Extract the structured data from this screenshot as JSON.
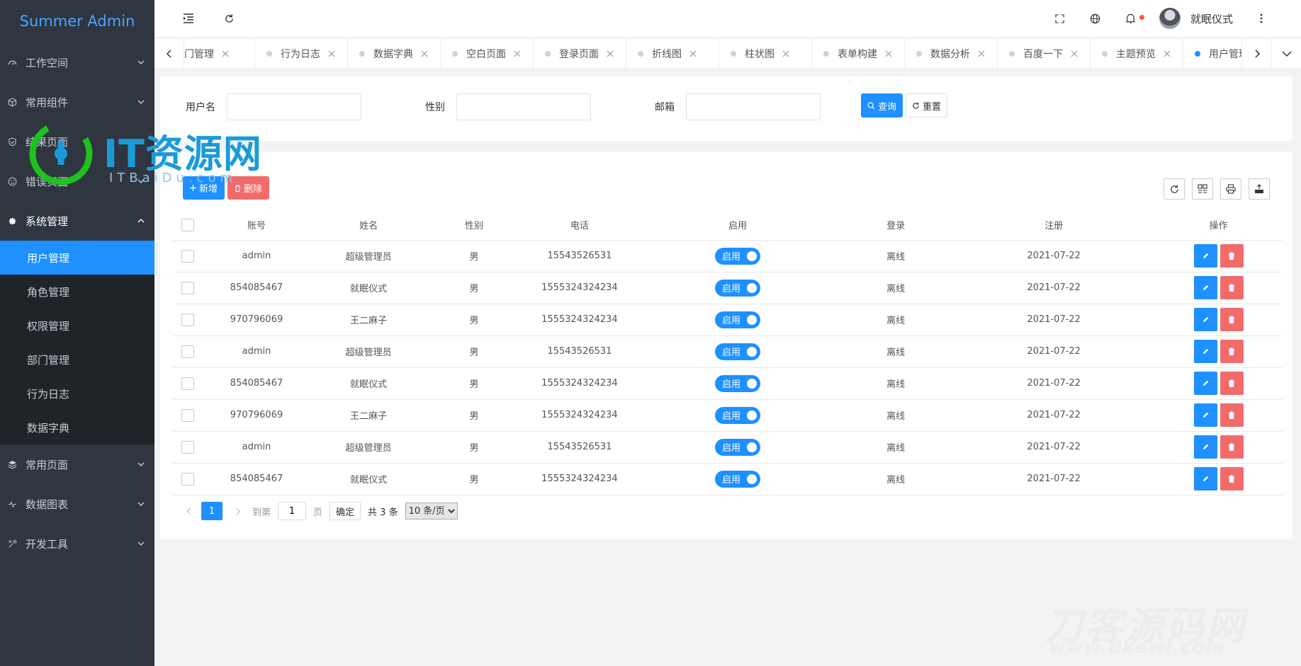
{
  "app": {
    "title": "Summer Admin"
  },
  "sidebar": {
    "top_items": [
      {
        "label": "工作空间",
        "icon": "dashboard-icon"
      },
      {
        "label": "常用组件",
        "icon": "cube-icon"
      },
      {
        "label": "结果页面",
        "icon": "shield-check-icon"
      },
      {
        "label": "错误页面",
        "icon": "face-icon"
      }
    ],
    "system": {
      "label": "系统管理",
      "icon": "gear-icon",
      "items": [
        {
          "label": "用户管理",
          "active": true
        },
        {
          "label": "角色管理"
        },
        {
          "label": "权限管理"
        },
        {
          "label": "部门管理"
        },
        {
          "label": "行为日志"
        },
        {
          "label": "数据字典"
        }
      ]
    },
    "bottom_items": [
      {
        "label": "常用页面",
        "icon": "layers-icon"
      },
      {
        "label": "数据图表",
        "icon": "pulse-icon"
      },
      {
        "label": "开发工具",
        "icon": "tools-icon"
      }
    ]
  },
  "header": {
    "user_name": "就眠仪式",
    "icons": [
      "menu-fold-icon",
      "refresh-icon",
      "fullscreen-icon",
      "globe-icon",
      "bell-icon",
      "more-vertical-icon"
    ]
  },
  "tabs": [
    {
      "label": "门管理",
      "partial": true
    },
    {
      "label": "行为日志"
    },
    {
      "label": "数据字典"
    },
    {
      "label": "空白页面"
    },
    {
      "label": "登录页面"
    },
    {
      "label": "折线图"
    },
    {
      "label": "柱状图"
    },
    {
      "label": "表单构建"
    },
    {
      "label": "数据分析"
    },
    {
      "label": "百度一下"
    },
    {
      "label": "主题预览"
    },
    {
      "label": "用户管理",
      "active": true
    }
  ],
  "search": {
    "username_label": "用户名",
    "username_value": "",
    "gender_label": "性别",
    "gender_value": "",
    "email_label": "邮箱",
    "email_value": "",
    "query_label": "查询",
    "reset_label": "重置"
  },
  "toolbar": {
    "add_label": "新增",
    "delete_label": "删除"
  },
  "table": {
    "columns": [
      "账号",
      "姓名",
      "性别",
      "电话",
      "启用",
      "登录",
      "注册",
      "操作"
    ],
    "rows": [
      {
        "account": "admin",
        "name": "超级管理员",
        "gender": "男",
        "phone": "15543526531",
        "enabled": "启用",
        "login": "离线",
        "registered": "2021-07-22"
      },
      {
        "account": "854085467",
        "name": "就眠仪式",
        "gender": "男",
        "phone": "1555324324234",
        "enabled": "启用",
        "login": "离线",
        "registered": "2021-07-22"
      },
      {
        "account": "970796069",
        "name": "王二麻子",
        "gender": "男",
        "phone": "1555324324234",
        "enabled": "启用",
        "login": "离线",
        "registered": "2021-07-22"
      },
      {
        "account": "admin",
        "name": "超级管理员",
        "gender": "男",
        "phone": "15543526531",
        "enabled": "启用",
        "login": "离线",
        "registered": "2021-07-22"
      },
      {
        "account": "854085467",
        "name": "就眠仪式",
        "gender": "男",
        "phone": "1555324324234",
        "enabled": "启用",
        "login": "离线",
        "registered": "2021-07-22"
      },
      {
        "account": "970796069",
        "name": "王二麻子",
        "gender": "男",
        "phone": "1555324324234",
        "enabled": "启用",
        "login": "离线",
        "registered": "2021-07-22"
      },
      {
        "account": "admin",
        "name": "超级管理员",
        "gender": "男",
        "phone": "15543526531",
        "enabled": "启用",
        "login": "离线",
        "registered": "2021-07-22"
      },
      {
        "account": "854085467",
        "name": "就眠仪式",
        "gender": "男",
        "phone": "1555324324234",
        "enabled": "启用",
        "login": "离线",
        "registered": "2021-07-22"
      }
    ]
  },
  "pagination": {
    "current_page": "1",
    "goto_label": "到第",
    "goto_value": "1",
    "page_unit": "页",
    "confirm_label": "确定",
    "total_label": "共 3 条",
    "page_size_label": "10 条/页"
  },
  "watermarks": {
    "top_logo": "IT资源网",
    "top_sub": "ITBaiDu.com",
    "bottom_logo": "刀客源码网",
    "bottom_sub": "www.dkewl.com"
  },
  "colors": {
    "sidebar_bg": "#2f3640",
    "submenu_bg": "#1f2429",
    "primary": "#1e90ff",
    "danger": "#f26b6b",
    "brand_text": "#4aa3ff"
  }
}
